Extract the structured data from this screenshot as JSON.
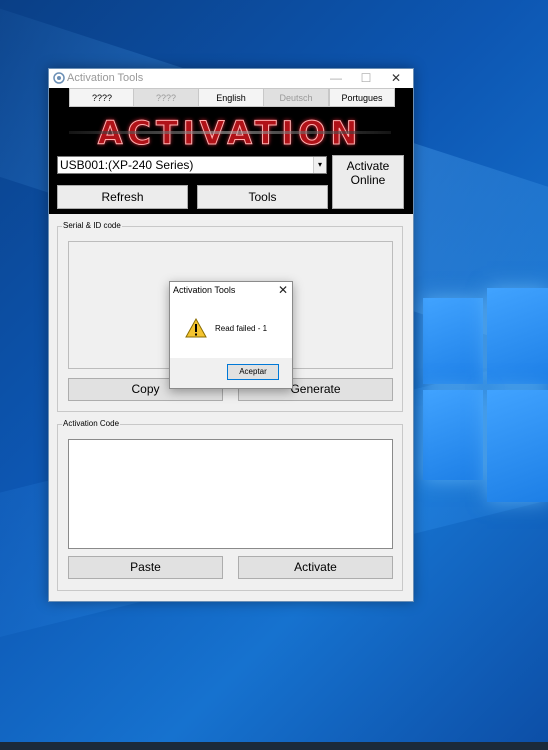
{
  "window": {
    "title": "Activation Tools",
    "controls": {
      "minimize": "—",
      "maximize": "☐",
      "close": "✕"
    }
  },
  "languages": [
    {
      "label": "????",
      "enabled": true
    },
    {
      "label": "????",
      "enabled": false
    },
    {
      "label": "English",
      "enabled": true
    },
    {
      "label": "Deutsch",
      "enabled": false
    },
    {
      "label": "Portugues",
      "enabled": true
    }
  ],
  "banner": {
    "text": "ACTIVATION"
  },
  "device_select": {
    "value": "USB001:(XP-240 Series)",
    "arrow": "▾"
  },
  "buttons": {
    "activate_online": "Activate Online",
    "refresh": "Refresh",
    "tools": "Tools",
    "copy": "Copy",
    "generate": "Generate",
    "paste": "Paste",
    "activate": "Activate"
  },
  "serial_group": {
    "label": "Serial & ID code"
  },
  "activation_group": {
    "label": "Activation Code"
  },
  "dialog": {
    "title": "Activation Tools",
    "close": "✕",
    "message": "Read failed - 1",
    "ok_label": "Aceptar",
    "icon": "warning-icon"
  },
  "colors": {
    "banner_red": "#b01218",
    "desktop_blue": "#0d57b3",
    "header_black": "#000000",
    "dialog_button_border": "#0078d7"
  }
}
